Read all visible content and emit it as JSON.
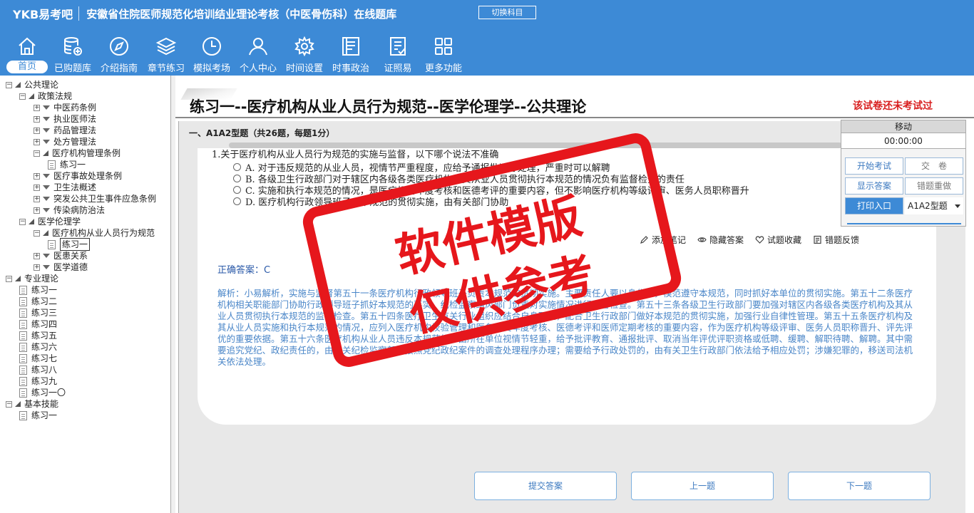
{
  "header": {
    "logo": "YKB易考吧",
    "title": "安徽省住院医师规范化培训结业理论考核（中医骨伤科）在线题库",
    "switch_label": "切换科目"
  },
  "nav": [
    {
      "label": "首页",
      "icon": "home-icon"
    },
    {
      "label": "已购题库",
      "icon": "database-icon"
    },
    {
      "label": "介绍指南",
      "icon": "compass-icon"
    },
    {
      "label": "章节练习",
      "icon": "layers-icon"
    },
    {
      "label": "模拟考场",
      "icon": "clock-icon"
    },
    {
      "label": "个人中心",
      "icon": "user-icon"
    },
    {
      "label": "时间设置",
      "icon": "gear-icon"
    },
    {
      "label": "时事政治",
      "icon": "news-icon"
    },
    {
      "label": "证照易",
      "icon": "checklist-icon"
    },
    {
      "label": "更多功能",
      "icon": "grid-icon"
    }
  ],
  "tree": [
    {
      "label": "公共理论",
      "level": 0,
      "kind": "open"
    },
    {
      "label": "政策法规",
      "level": 1,
      "kind": "open"
    },
    {
      "label": "中医药条例",
      "level": 2,
      "kind": "closed"
    },
    {
      "label": "执业医师法",
      "level": 2,
      "kind": "closed"
    },
    {
      "label": "药品管理法",
      "level": 2,
      "kind": "closed"
    },
    {
      "label": "处方管理法",
      "level": 2,
      "kind": "closed"
    },
    {
      "label": "医疗机构管理条例",
      "level": 2,
      "kind": "open"
    },
    {
      "label": "练习一",
      "level": 3,
      "kind": "doc"
    },
    {
      "label": "医疗事故处理条例",
      "level": 2,
      "kind": "closed"
    },
    {
      "label": "卫生法概述",
      "level": 2,
      "kind": "closed"
    },
    {
      "label": "突发公共卫生事件应急条例",
      "level": 2,
      "kind": "closed"
    },
    {
      "label": "传染病防治法",
      "level": 2,
      "kind": "closed"
    },
    {
      "label": "医学伦理学",
      "level": 1,
      "kind": "open"
    },
    {
      "label": "医疗机构从业人员行为规范",
      "level": 2,
      "kind": "open"
    },
    {
      "label": "练习一",
      "level": 3,
      "kind": "doc-selected"
    },
    {
      "label": "医患关系",
      "level": 2,
      "kind": "closed"
    },
    {
      "label": "医学道德",
      "level": 2,
      "kind": "closed"
    },
    {
      "label": "专业理论",
      "level": 0,
      "kind": "open"
    },
    {
      "label": "练习一",
      "level": 1,
      "kind": "doc"
    },
    {
      "label": "练习二",
      "level": 1,
      "kind": "doc"
    },
    {
      "label": "练习三",
      "level": 1,
      "kind": "doc"
    },
    {
      "label": "练习四",
      "level": 1,
      "kind": "doc"
    },
    {
      "label": "练习五",
      "level": 1,
      "kind": "doc"
    },
    {
      "label": "练习六",
      "level": 1,
      "kind": "doc"
    },
    {
      "label": "练习七",
      "level": 1,
      "kind": "doc"
    },
    {
      "label": "练习八",
      "level": 1,
      "kind": "doc"
    },
    {
      "label": "练习九",
      "level": 1,
      "kind": "doc"
    },
    {
      "label": "练习一〇",
      "level": 1,
      "kind": "doc"
    },
    {
      "label": "基本技能",
      "level": 0,
      "kind": "open"
    },
    {
      "label": "练习一",
      "level": 1,
      "kind": "doc"
    }
  ],
  "main": {
    "title": "练习一--医疗机构从业人员行为规范--医学伦理学--公共理论",
    "status": "该试卷还未考试过",
    "section": "一、A1A2型题（共26题，每题1分）",
    "question": "1.关于医疗机构从业人员行为规范的实施与监督，以下哪个说法不准确",
    "options": [
      "A. 对于违反规范的从业人员，视情节严重程度，应给予通报批评等处理，严重时可以解聘",
      "B. 各级卫生行政部门对于辖区内各级各类医疗机构及其从业人员贯彻执行本规范的情况负有监督检查的责任",
      "C. 实施和执行本规范的情况，是医疗机构年度考核和医德考评的重要内容，但不影响医疗机构等级评审、医务人员职称晋升",
      "D. 医疗机构行政领导班子对本规范的贯彻实施，由有关部门协助"
    ],
    "tools": [
      "添加笔记",
      "隐藏答案",
      "试题收藏",
      "错题反馈"
    ],
    "answer": "正确答案：C",
    "analysis": "解析：小易解析，实施与监督第五十一条医疗机构行政领导班子负责本规范的贯彻实施。主要责任人要以身作则，模范遵守本规范，同时抓好本单位的贯彻实施。第五十二条医疗机构相关职能部门协助行政领导班子抓好本规范的落实，纪检监察纠风部门负责对实施情况进行监督检查。第五十三条各级卫生行政部门要加强对辖区内各级各类医疗机构及其从业人员贯彻执行本规范的监督检查。第五十四条医疗卫生有关行业组织应结合自身职责，配合卫生行政部门做好本规范的贯彻实施，加强行业自律性管理。第五十五条医疗机构及其从业人员实施和执行本规范的情况，应列入医疗机构校验管理和医务人员年度考核、医德考评和医师定期考核的重要内容，作为医疗机构等级评审、医务人员职称晋升、评先评优的重要依据。第五十六条医疗机构从业人员违反本规范的，由所在单位视情节轻重，给予批评教育、通报批评、取消当年评优评职资格或低聘、缓聘、解职待聘、解聘。其中需要追究党纪、政纪责任的，由有关纪检监察部门按照党纪政纪案件的调查处理程序办理；需要给予行政处罚的，由有关卫生行政部门依法给予相应处罚；涉嫌犯罪的，移送司法机关依法处理。",
    "buttons": {
      "submit": "提交答案",
      "prev": "上一题",
      "next": "下一题"
    }
  },
  "panel": {
    "head": "移动",
    "timer": "00:00:00",
    "start": "开始考试",
    "hand_in": "交　卷",
    "show_answer": "显示答案",
    "redo_wrong": "错题重做",
    "print": "打印入口",
    "type_select": "A1A2型题"
  },
  "watermark": {
    "line1": "软件模版",
    "line2": "仅供参考"
  },
  "colors": {
    "brand": "#3d8ad6",
    "stamp": "#e6171c",
    "status": "#d81e1e"
  }
}
